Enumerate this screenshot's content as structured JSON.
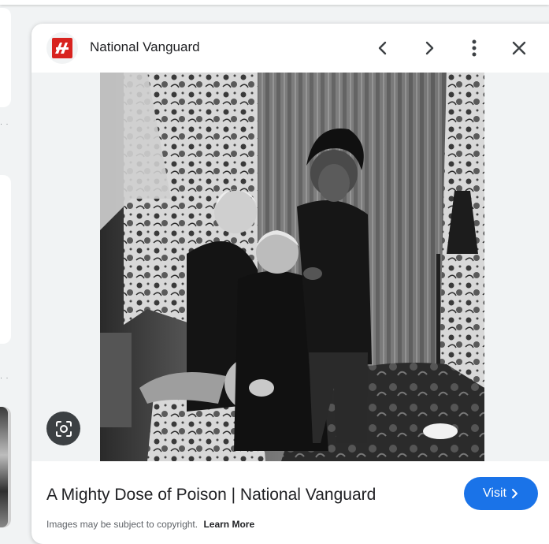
{
  "panel": {
    "site_name": "National Vanguard",
    "title": "A Mighty Dose of Poison | National Vanguard",
    "visit_label": "Visit",
    "copyright_text": "Images may be subject to copyright.",
    "learn_more_label": "Learn More",
    "image_alt": "Black and white photograph of three people posed in a room with patterned curtains"
  },
  "icons": {
    "favicon": "national-vanguard-logo",
    "prev": "chevron-left-icon",
    "next": "chevron-right-icon",
    "more": "more-vert-icon",
    "close": "close-icon",
    "lens": "google-lens-icon",
    "visit_chevron": "chevron-right-icon"
  },
  "colors": {
    "accent": "#1a73e8",
    "logo_red": "#d8231f",
    "lens_bg": "#3c4043"
  }
}
